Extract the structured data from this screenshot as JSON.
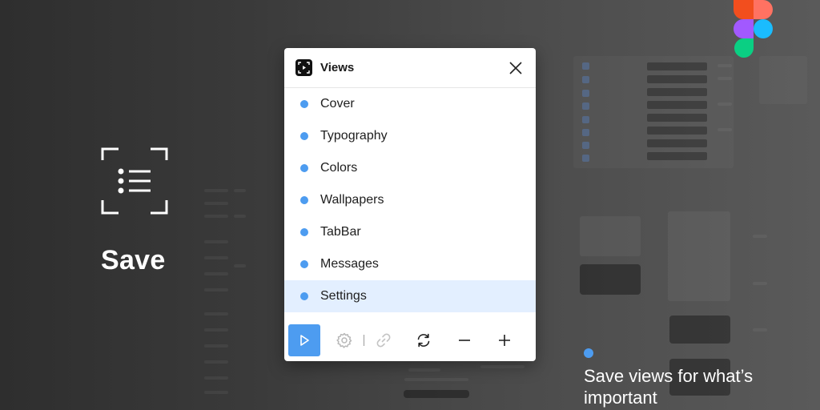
{
  "hero": {
    "title": "Save"
  },
  "dialog": {
    "title": "Views",
    "items": [
      {
        "label": "Cover"
      },
      {
        "label": "Typography"
      },
      {
        "label": "Colors"
      },
      {
        "label": "Wallpapers"
      },
      {
        "label": "TabBar"
      },
      {
        "label": "Messages"
      },
      {
        "label": "Settings",
        "selected": true
      }
    ],
    "toolbar": [
      "play-icon",
      "settings-icon",
      "link-icon",
      "sync-icon",
      "minus-icon",
      "plus-icon"
    ]
  },
  "caption": {
    "text": "Save views for what’s important"
  },
  "colors": {
    "accent": "#4d9cf0",
    "selected_row": "#e3efff"
  }
}
